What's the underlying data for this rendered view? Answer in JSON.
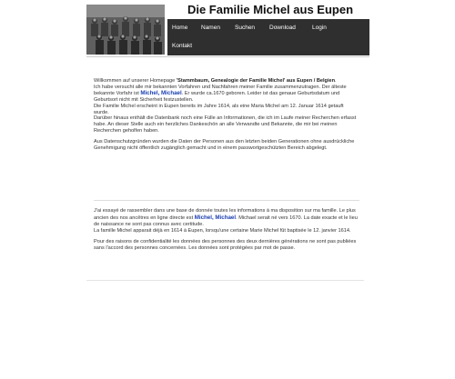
{
  "site": {
    "title": "Die Familie Michel aus Eupen"
  },
  "nav": {
    "home": "Home",
    "namen": "Namen",
    "suchen": "Suchen",
    "download": "Download",
    "login": "Login",
    "kontakt": "Kontakt"
  },
  "de": {
    "p1_intro": "Willkommen auf unserer Homepage ",
    "p1_bold": "'Stammbaum, Genealogie der Familie Michel' aus Eupen / Belgien",
    "p1_end": ".",
    "p2_a": "Ich habe versucht alle mir bekannten Vorfahren und Nachfahren meiner Familie zusammenzutragen. Der älteste bekannte Vorfahr ist ",
    "p2_link": "Michel, Michael",
    "p2_b": ". Er wurde ca.1670 geboren. Leider ist das genaue Geburtsdatum und Geburtsort nicht mit Sicherheit festzustellen.",
    "p3": "Die Familie Michel erscheint in Eupen bereits im Jahre 1614, als eine Maria Michel am 12. Januar 1614 getauft wurde.",
    "p4": "Darüber hinaus enthält die Datenbank noch eine Fülle an Informationen, die ich im Laufe meiner Recherchen erfasst habe. An dieser Stelle auch ein herzliches Dankeschön an alle Verwandte und Bekannte, die mir bei meinen Recherchen geholfen haben.",
    "p5": "Aus Datenschutzgründen wurden die Daten der Personen aus den letzten beiden Generationen ohne ausdrückliche Genehmigung nicht öffentlich zugänglich gemacht und in einem passwortgeschützten Bereich abgelegt."
  },
  "fr": {
    "p1_a": "J'ai essayé de rassembler dans une base de donnée toutes les informations à ma disposition sur ma famille. Le plus ancien des nos ancêtres en ligne directe est ",
    "p1_link": "Michel, Michael",
    "p1_b": ". Michael serait né vers 1670. La date exacte et le lieu de naissance ne sont pas connus avec certitude.",
    "p2": "La famille Michel apparait déjà en 1614 à Eupen, lorsqu'une certaine Marie Michel fût baptisée le 12. janvier 1614.",
    "p3": "Pour des raisons de confidentialité les données des personnes des deux dernières générations ne sont pas publiées sans l'accord des personnes concernées. Les données sont protégées par mot de passe."
  },
  "colors": {
    "nav_bg": "#2f2f2f",
    "link": "#1a3fb0"
  }
}
